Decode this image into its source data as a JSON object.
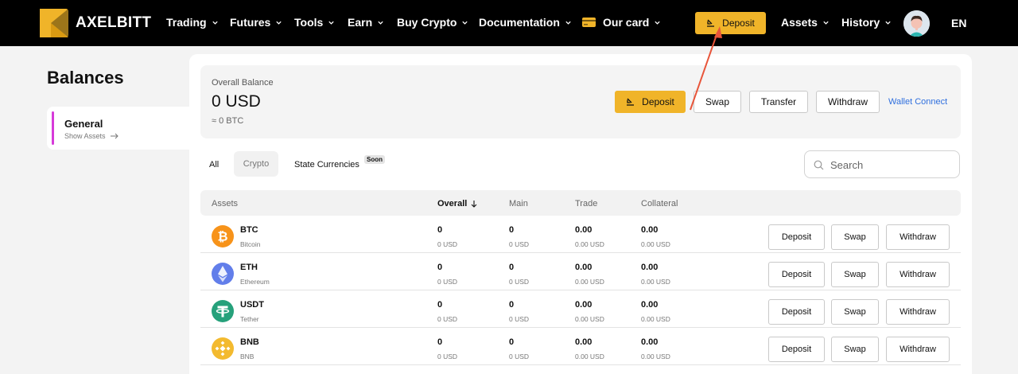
{
  "brand": {
    "name": "AXELBITT"
  },
  "nav": {
    "items": [
      "Trading",
      "Futures",
      "Tools",
      "Earn",
      "Buy Crypto",
      "Documentation"
    ],
    "card": "Our card",
    "deposit": "Deposit",
    "assets": "Assets",
    "history": "History",
    "lang": "EN"
  },
  "sidebar": {
    "title": "Balances",
    "item_title": "General",
    "item_sub": "Show Assets"
  },
  "balance": {
    "label": "Overall Balance",
    "value": "0 USD",
    "btc": "≈ 0 BTC",
    "deposit": "Deposit",
    "swap": "Swap",
    "transfer": "Transfer",
    "withdraw": "Withdraw",
    "wallet_connect": "Wallet Connect"
  },
  "tabs": {
    "all": "All",
    "crypto": "Crypto",
    "state": "State Currencies",
    "soon": "Soon"
  },
  "search": {
    "placeholder": "Search"
  },
  "table": {
    "headers": {
      "assets": "Assets",
      "overall": "Overall",
      "main": "Main",
      "trade": "Trade",
      "collateral": "Collateral"
    },
    "rows": [
      {
        "symbol": "BTC",
        "name": "Bitcoin",
        "overall": "0",
        "overall_usd": "0 USD",
        "main": "0",
        "main_usd": "0 USD",
        "trade": "0.00",
        "trade_usd": "0.00 USD",
        "collateral": "0.00",
        "collateral_usd": "0.00 USD",
        "deposit": "Deposit",
        "swap": "Swap",
        "withdraw": "Withdraw"
      },
      {
        "symbol": "ETH",
        "name": "Ethereum",
        "overall": "0",
        "overall_usd": "0 USD",
        "main": "0",
        "main_usd": "0 USD",
        "trade": "0.00",
        "trade_usd": "0.00 USD",
        "collateral": "0.00",
        "collateral_usd": "0.00 USD",
        "deposit": "Deposit",
        "swap": "Swap",
        "withdraw": "Withdraw"
      },
      {
        "symbol": "USDT",
        "name": "Tether",
        "overall": "0",
        "overall_usd": "0 USD",
        "main": "0",
        "main_usd": "0 USD",
        "trade": "0.00",
        "trade_usd": "0.00 USD",
        "collateral": "0.00",
        "collateral_usd": "0.00 USD",
        "deposit": "Deposit",
        "swap": "Swap",
        "withdraw": "Withdraw"
      },
      {
        "symbol": "BNB",
        "name": "BNB",
        "overall": "0",
        "overall_usd": "0 USD",
        "main": "0",
        "main_usd": "0 USD",
        "trade": "0.00",
        "trade_usd": "0.00 USD",
        "collateral": "0.00",
        "collateral_usd": "0.00 USD",
        "deposit": "Deposit",
        "swap": "Swap",
        "withdraw": "Withdraw"
      }
    ]
  },
  "colors": {
    "accent": "#f0b429",
    "link": "#2f6fde",
    "sidebar_marker": "#d63ad9",
    "annotation_arrow": "#e8553a",
    "btc": "#f7931a",
    "eth": "#627eea",
    "usdt": "#26a17b",
    "bnb": "#f3ba2f"
  },
  "icons": {
    "logo": "axelbitt-logo",
    "chevron": "chevron-down-icon",
    "card": "card-icon",
    "deposit": "download-icon",
    "search": "search-icon",
    "sort": "arrow-down-icon",
    "show_assets": "arrow-right-icon"
  }
}
